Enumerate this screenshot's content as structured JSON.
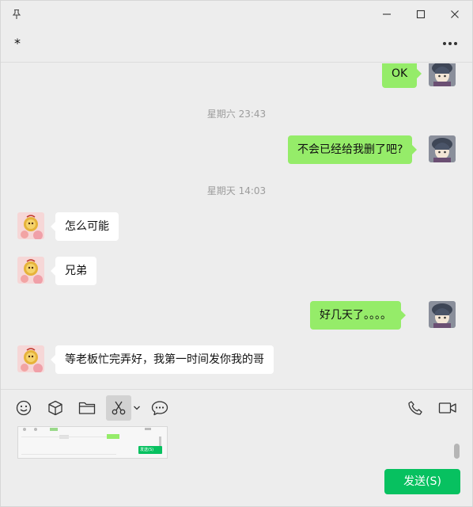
{
  "chat": {
    "title": "*",
    "messages": [
      {
        "text": "OK"
      },
      {
        "timestamp": "星期六 23:43"
      },
      {
        "text": "不会已经给我删了吧?"
      },
      {
        "timestamp": "星期天 14:03"
      },
      {
        "text": "怎么可能"
      },
      {
        "text": "兄弟"
      },
      {
        "text": "好几天了。。。。"
      },
      {
        "text": "等老板忙完弄好，我第一时间发你我的哥"
      }
    ]
  },
  "composer": {
    "send_label": "发送(S)",
    "thumb_button_label": "发送(S)"
  },
  "colors": {
    "accent": "#07c160",
    "bubble_me": "#95ec69",
    "bubble_other": "#ffffff",
    "background": "#ededed"
  },
  "icons": [
    "pin-icon",
    "minimize-icon",
    "maximize-icon",
    "close-icon",
    "more-icon",
    "emoji-icon",
    "sticker-box-icon",
    "folder-icon",
    "scissors-icon",
    "chevron-down-icon",
    "chat-history-icon",
    "phone-icon",
    "video-icon"
  ]
}
